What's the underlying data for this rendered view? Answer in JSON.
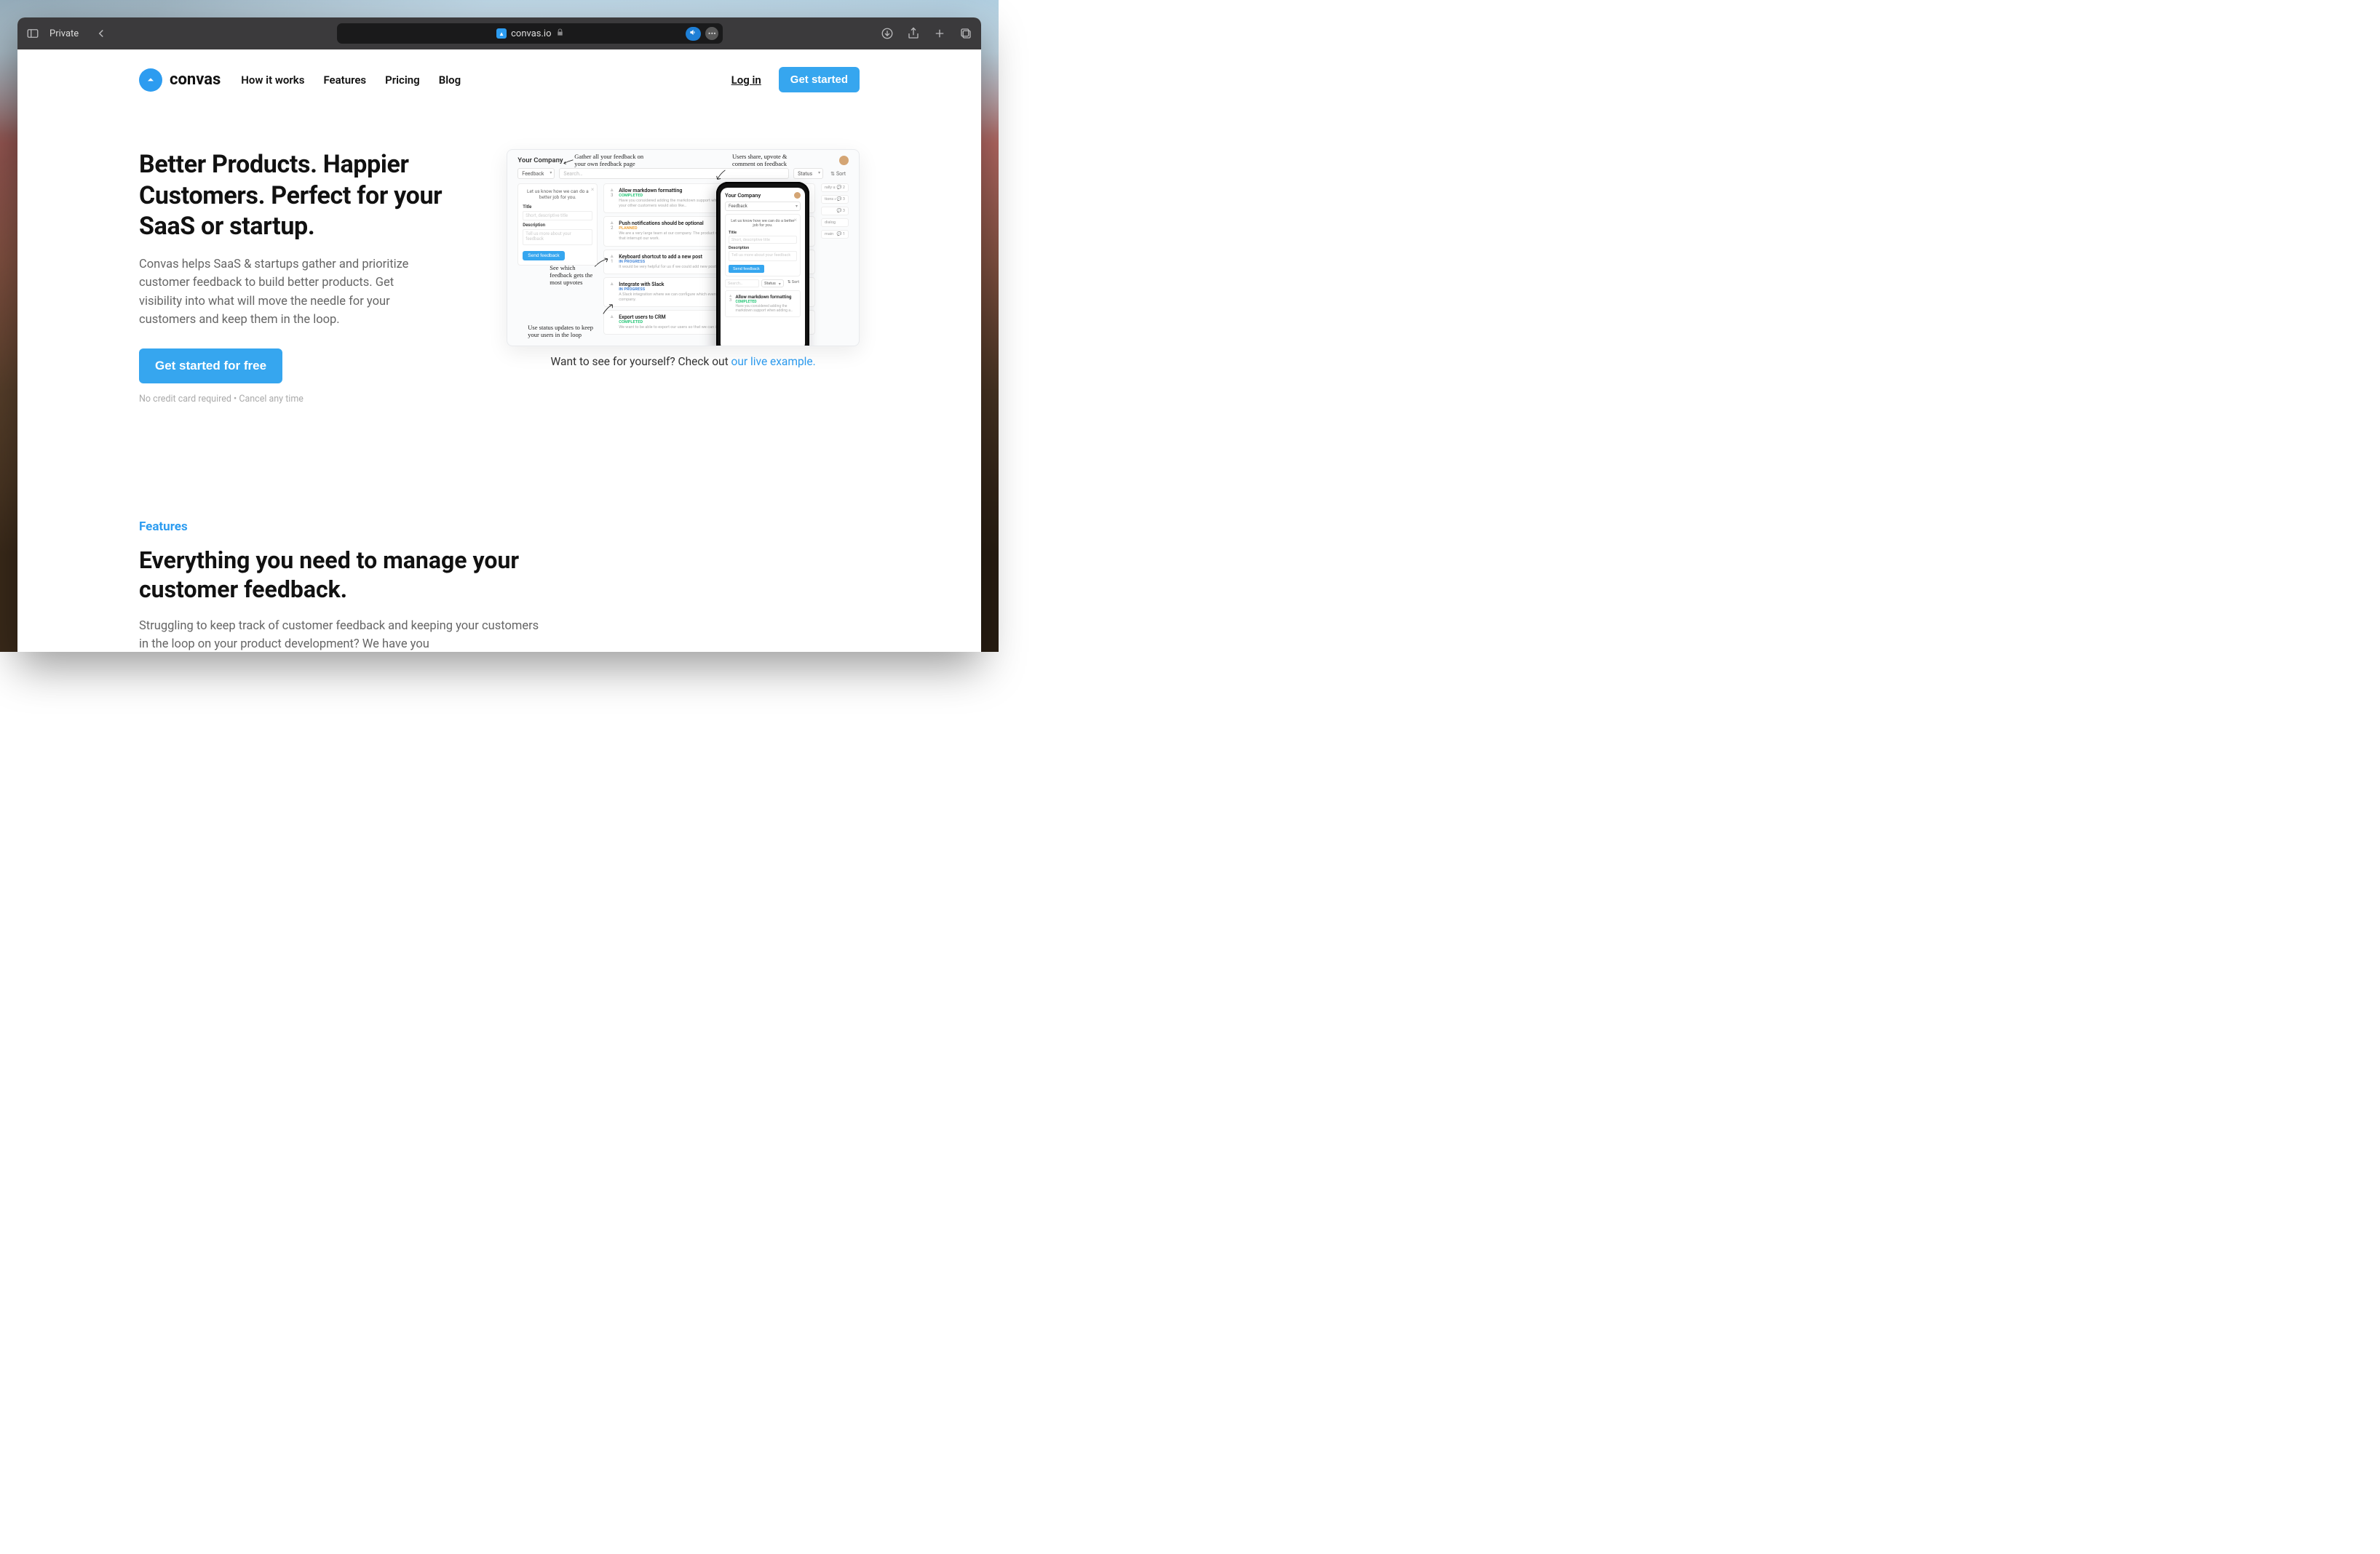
{
  "browser": {
    "private_label": "Private",
    "domain": "convas.io"
  },
  "nav": {
    "logo_text": "convas",
    "items": [
      "How it works",
      "Features",
      "Pricing",
      "Blog"
    ],
    "login": "Log in",
    "cta": "Get started"
  },
  "hero": {
    "title": "Better Products. Happier Customers. Perfect for your SaaS or startup.",
    "subtitle": "Convas helps SaaS & startups gather and prioritize customer feedback to build better products. Get visibility into what will move the needle for your customers and keep them in the loop.",
    "cta": "Get started for free",
    "fine": "No credit card required • Cancel any time",
    "live_prefix": "Want to see for yourself? Check out ",
    "live_link": "our live example."
  },
  "features": {
    "tag": "Features",
    "title": "Everything you need to manage your customer feedback.",
    "body": "Struggling to keep track of customer feedback and keeping your customers in the loop on your product development? We have you"
  },
  "mock": {
    "company": "Your Company",
    "board_select": "Feedback",
    "search_placeholder": "Search…",
    "status_select": "Status",
    "sort_label": "Sort",
    "form_hint": "Let us know how we can do a better job for you.",
    "label_title": "Title",
    "label_description": "Description",
    "placeholder_title": "Short, descriptive title",
    "placeholder_desc": "Tell us more about your feedback",
    "submit": "Send feedback",
    "posts": [
      {
        "votes": "3",
        "title": "Allow markdown formatting",
        "status": "COMPLETED",
        "status_cls": "completed",
        "desc": "Have you considered adding the markdown support when adding posts? People and bloggers, so I think your other customers would also like…",
        "comments": "2"
      },
      {
        "votes": "2",
        "title": "Push notifications should be optional",
        "status": "PLANNED",
        "status_cls": "planned",
        "desc": "We are a very large team at our company. The product works great – we simply get too many notifications that interrupt our work.",
        "comments": "2"
      },
      {
        "votes": "1",
        "title": "Keyboard shortcut to add a new post",
        "status": "IN PROGRESS",
        "status_cls": "inprogress",
        "desc": "It would be very helpful for us if we could add new posts using a keyboard…",
        "comments": "3"
      },
      {
        "votes": "",
        "title": "Integrate with Slack",
        "status": "IN PROGRESS",
        "status_cls": "inprogress",
        "desc": "A Slack integration where we can configure which events are sent to our communications hub for our company.",
        "comments": ""
      },
      {
        "votes": "",
        "title": "Export users to CRM",
        "status": "COMPLETED",
        "status_cls": "completed",
        "desc": "We want to be able to export our users so that we can import them…",
        "comments": "1"
      }
    ],
    "side_pills": [
      {
        "desc": "rally used by tech",
        "count": "2"
      },
      {
        "desc": "tions are sent as",
        "count": "3"
      },
      {
        "desc": "",
        "count": "3"
      },
      {
        "desc": "dialog",
        "count": ""
      },
      {
        "desc": "main",
        "count": "1"
      }
    ],
    "annotations": {
      "top_left": "Gather all your feedback on your own feedback page",
      "top_right": "Users share, upvote & comment on feedback",
      "mid": "See which feedback gets the most upvotes",
      "bottom": "Use status updates to keep your users in the loop"
    },
    "phone": {
      "title": "Your Company",
      "board": "Feedback",
      "hint": "Let us know how we can do a better job for you.",
      "label_title": "Title",
      "placeholder_title": "Short, descriptive title",
      "label_desc": "Description",
      "placeholder_desc": "Tell us more about your feedback",
      "submit": "Send feedback",
      "search": "Search…",
      "status": "Status",
      "sort": "Sort",
      "card_title": "Allow markdown formatting",
      "card_status": "COMPLETED",
      "card_desc": "Have you considered adding the markdown support when adding a…",
      "card_votes": "3"
    }
  }
}
